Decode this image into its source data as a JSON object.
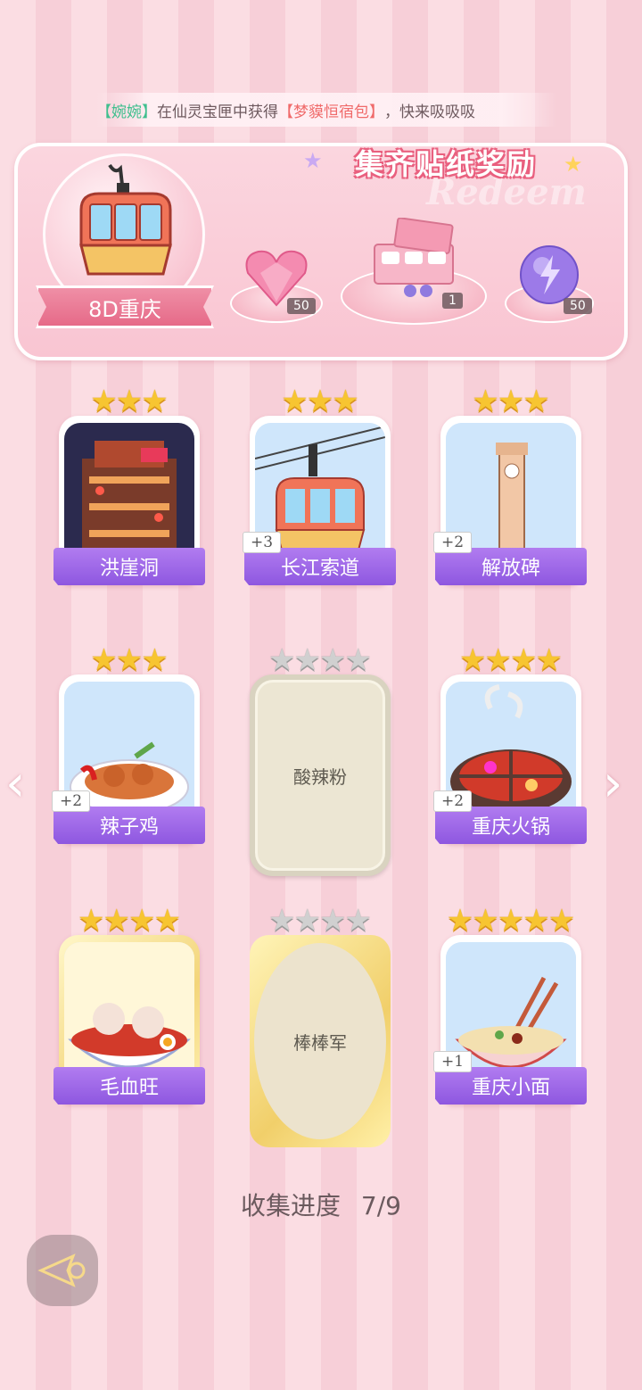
{
  "ticker": {
    "name": "【婉婉】",
    "mid": "在仙灵宝匣中获得",
    "item": "【梦貘恒宿包】",
    "tail": "，快来吸吸吸"
  },
  "banner": {
    "title": "集齐贴纸奖励",
    "watermark": "Redeem",
    "set_name": "8D重庆",
    "rewards": [
      {
        "icon": "pink-heart-gem-icon",
        "count": "50"
      },
      {
        "icon": "gift-box-icon",
        "count": "1"
      },
      {
        "icon": "purple-lightning-orb-icon",
        "count": "50"
      }
    ]
  },
  "cards": [
    {
      "label": "洪崖洞",
      "stars": 3,
      "max_stars": 3,
      "badge": "",
      "state": "owned",
      "icon": "hongyadong-building-icon"
    },
    {
      "label": "长江索道",
      "stars": 3,
      "max_stars": 3,
      "badge": "+3",
      "state": "owned",
      "icon": "cable-car-icon"
    },
    {
      "label": "解放碑",
      "stars": 3,
      "max_stars": 3,
      "badge": "+2",
      "state": "owned",
      "icon": "monument-tower-icon"
    },
    {
      "label": "辣子鸡",
      "stars": 3,
      "max_stars": 3,
      "badge": "+2",
      "state": "owned",
      "icon": "spicy-chicken-icon"
    },
    {
      "label": "酸辣粉",
      "stars": 0,
      "max_stars": 4,
      "badge": "",
      "state": "locked",
      "icon": ""
    },
    {
      "label": "重庆火锅",
      "stars": 4,
      "max_stars": 4,
      "badge": "+2",
      "state": "owned",
      "icon": "hotpot-icon"
    },
    {
      "label": "毛血旺",
      "stars": 4,
      "max_stars": 4,
      "badge": "",
      "state": "owned-gold",
      "icon": "maoxuewang-bowl-icon"
    },
    {
      "label": "棒棒军",
      "stars": 0,
      "max_stars": 4,
      "badge": "",
      "state": "locked-gold",
      "icon": ""
    },
    {
      "label": "重庆小面",
      "stars": 5,
      "max_stars": 5,
      "badge": "+1",
      "state": "owned",
      "icon": "noodle-bowl-icon"
    }
  ],
  "progress": {
    "label": "收集进度",
    "value": "7/9"
  },
  "colors": {
    "label_purple": "#9a63e6",
    "banner_pink": "#f9c5d2",
    "star_gold": "#f7c531"
  }
}
